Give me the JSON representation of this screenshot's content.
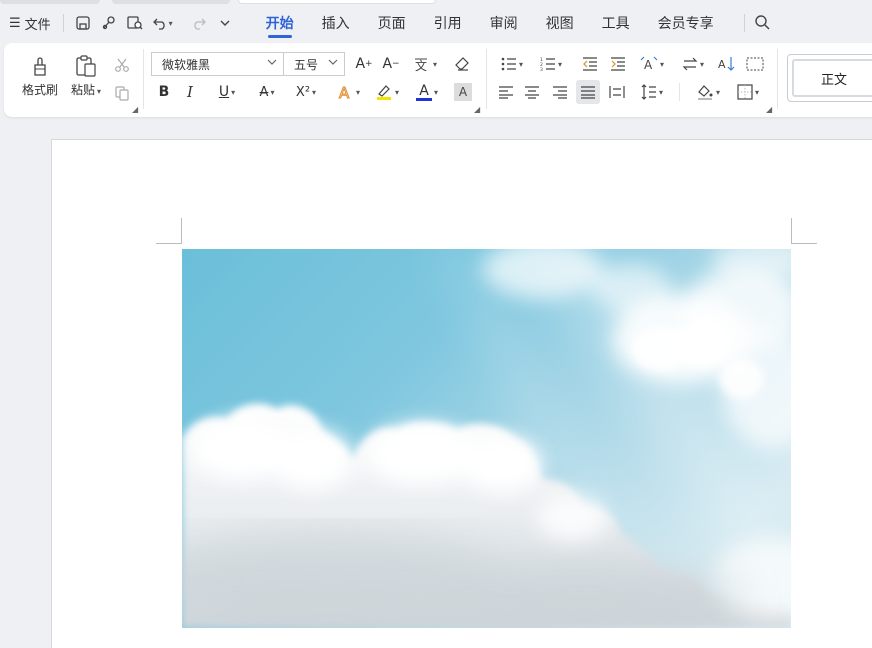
{
  "menubar": {
    "file_label": "文件",
    "tabs": [
      {
        "label": "开始",
        "active": true
      },
      {
        "label": "插入",
        "active": false
      },
      {
        "label": "页面",
        "active": false
      },
      {
        "label": "引用",
        "active": false
      },
      {
        "label": "审阅",
        "active": false
      },
      {
        "label": "视图",
        "active": false
      },
      {
        "label": "工具",
        "active": false
      },
      {
        "label": "会员专享",
        "active": false
      }
    ]
  },
  "ribbon": {
    "format_painter_label": "格式刷",
    "paste_label": "粘贴",
    "font_name": "微软雅黑",
    "font_size": "五号",
    "bold": "B",
    "italic": "I",
    "underline": "U",
    "superscript": "X²",
    "font_color_glyph": "A",
    "char_shading_glyph": "A",
    "style_current": "正文"
  },
  "colors": {
    "accent": "#2f63d8",
    "highlight": "#f5e400",
    "font_color": "#1f35d6"
  },
  "document": {
    "image": "sky-with-clouds"
  }
}
